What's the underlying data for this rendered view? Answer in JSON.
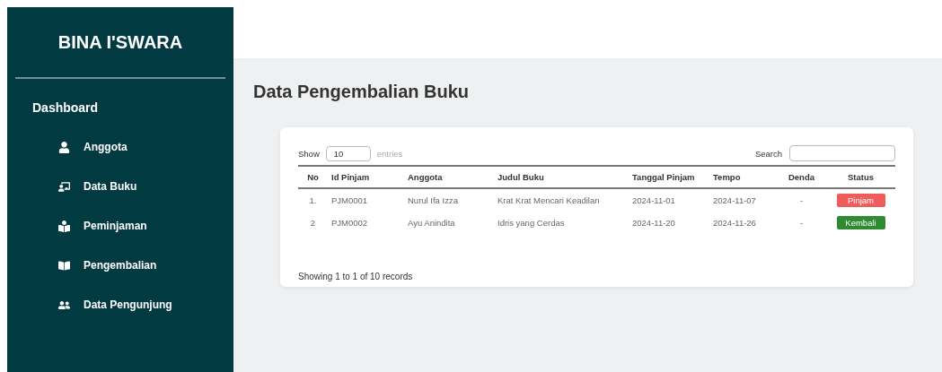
{
  "sidebar": {
    "brand": "BINA I'SWARA",
    "section": "Dashboard",
    "items": [
      {
        "label": "Anggota"
      },
      {
        "label": "Data Buku"
      },
      {
        "label": "Peminjaman"
      },
      {
        "label": "Pengembalian"
      },
      {
        "label": "Data Pengunjung"
      }
    ]
  },
  "page_title": "Data Pengembalian Buku",
  "table_controls": {
    "show_label": "Show",
    "entries_value": "10",
    "entries_label": "entries",
    "search_label": "Search"
  },
  "table": {
    "columns": [
      "No",
      "Id Pinjam",
      "Anggota",
      "Judul Buku",
      "Tanggal Pinjam",
      "Tempo",
      "Denda",
      "Status"
    ],
    "rows": [
      {
        "cells": [
          "1.",
          "PJM0001",
          "Nurul Ifa Izza",
          "Krat Krat Mencari Keadilan",
          "2024-11-01",
          "2024-11-07",
          "-"
        ],
        "status": {
          "label": "Pinjam",
          "kind": "borrowed"
        }
      },
      {
        "cells": [
          "2",
          "PJM0002",
          "Ayu Anindita",
          "Idris yang Cerdas",
          "2024-11-20",
          "2024-11-26",
          "-"
        ],
        "status": {
          "label": "Kembali",
          "kind": "returned"
        }
      }
    ]
  },
  "footer_info": "Showing 1 to 1 of 10 records"
}
